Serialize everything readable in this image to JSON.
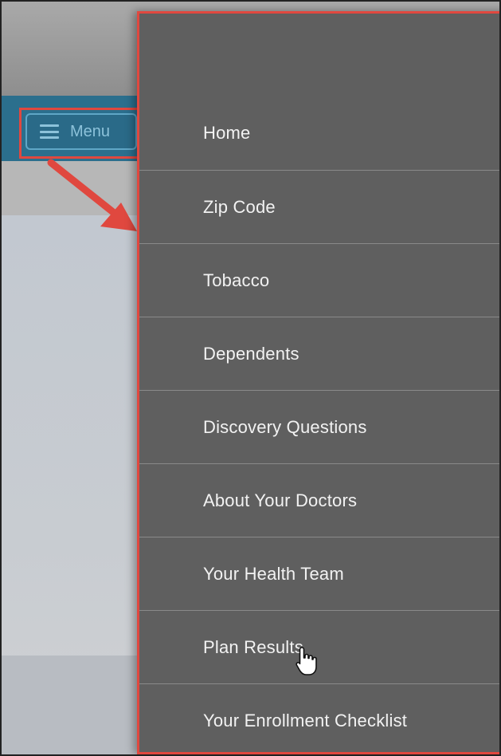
{
  "header": {
    "menu_button_label": "Menu"
  },
  "drawer": {
    "items": [
      {
        "label": "Home"
      },
      {
        "label": "Zip Code"
      },
      {
        "label": "Tobacco"
      },
      {
        "label": "Dependents"
      },
      {
        "label": "Discovery Questions"
      },
      {
        "label": "About Your Doctors"
      },
      {
        "label": "Your Health Team"
      },
      {
        "label": "Plan Results"
      },
      {
        "label": "Your Enrollment Checklist"
      }
    ]
  },
  "annotations": {
    "highlight_color": "#e0483f",
    "arrow_icon": "arrow-down-right-icon"
  },
  "colors": {
    "nav_bar": "#2b6f8d",
    "drawer_bg": "#5f5f5f",
    "drawer_text": "#f2f2f2"
  }
}
